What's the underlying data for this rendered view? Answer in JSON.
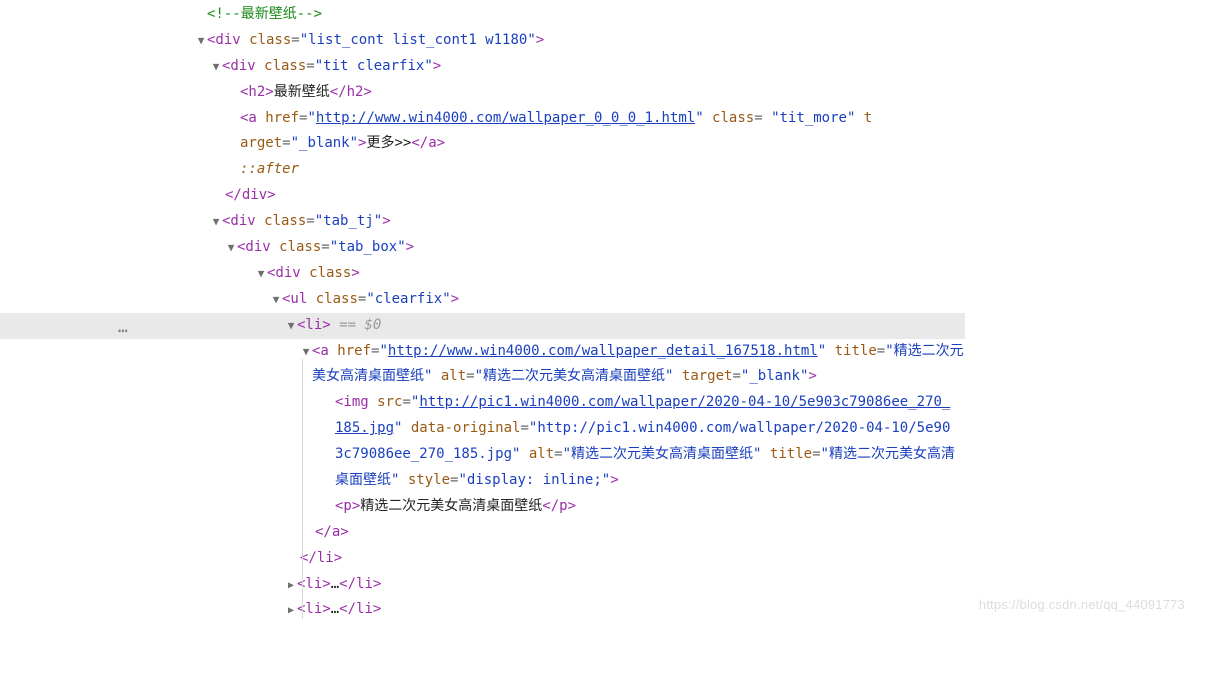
{
  "comment": "<!--最新壁纸-->",
  "l1": {
    "open": "<div",
    "cls_attr": " class",
    "eq": "=",
    "q": "\"",
    "cls_val": "list_cont list_cont1 w1180",
    "close": ">"
  },
  "l2": {
    "open": "<div",
    "cls_attr": " class",
    "eq": "=",
    "q": "\"",
    "cls_val": "tit clearfix",
    "close": ">"
  },
  "l3": {
    "open": "<h2>",
    "text": "最新壁纸",
    "close": "</h2>"
  },
  "l4": {
    "open": "<a",
    "href_attr": " href",
    "eq": "=",
    "q": "\"",
    "href_val": "http://www.win4000.com/wallpaper_0_0_0_1.html",
    "cls_attr": " class",
    "cls_val": "tit_more",
    "tgt_attr": " target",
    "tgt_val": "_blank",
    "text": "更多",
    "gtgt": ">>",
    "close_a": "</a>"
  },
  "l5": {
    "pseudo": "::after"
  },
  "l6": {
    "close": "</div>"
  },
  "l7": {
    "open": "<div",
    "cls_attr": " class",
    "eq": "=",
    "q": "\"",
    "cls_val": "tab_tj",
    "close": ">"
  },
  "l8": {
    "open": "<div",
    "cls_attr": " class",
    "eq": "=",
    "q": "\"",
    "cls_val": "tab_box",
    "close": ">"
  },
  "l9": {
    "open": "<div",
    "cls_attr": " class",
    "close": ">"
  },
  "l10": {
    "open": "<ul",
    "cls_attr": " class",
    "eq": "=",
    "q": "\"",
    "cls_val": "clearfix",
    "close": ">"
  },
  "l11": {
    "open": "<li>",
    "hint": " == $0"
  },
  "l12": {
    "open": "<a",
    "href_attr": " href",
    "eq": "=",
    "q": "\"",
    "href_val": "http://www.win4000.com/wallpaper_detail_167518.html",
    "title_attr": "title",
    "title_val": "精选二次元美女高清桌面壁纸",
    "alt_attr": " alt",
    "alt_val": "精选二次元美女高清桌面壁纸",
    "tgt_attr": " target",
    "tgt_val": "_blank",
    "close": ">"
  },
  "l13": {
    "open": "<img",
    "src_attr": " src",
    "eq": "=",
    "q": "\"",
    "src_val": "http://pic1.win4000.com/wallpaper/2020-04-10/5e903c79086ee_270_185.jpg",
    "do_attr": " data-original",
    "do_val_p1": "http://",
    "do_val_p2": "pic1.win4000.com/wallpaper/2020-04-10/",
    "do_val_p3": "5e903c79086ee_270_185.jpg",
    "alt_attr": " alt",
    "alt_val": "精选二次元美女高清桌面壁纸",
    "title_attr": "title",
    "title_val": "精选二次元美女高清桌面壁纸",
    "style_attr": " style",
    "style_val": "display: inline;",
    "close": ">"
  },
  "l14": {
    "open": "<p>",
    "text": "精选二次元美女高清桌面壁纸",
    "close": "</p>"
  },
  "l15": {
    "close": "</a>"
  },
  "l16": {
    "close": "</li>"
  },
  "l17": {
    "open": "<li>",
    "dots": "…",
    "close": "</li>"
  },
  "l18": {
    "open": "<li>",
    "dots": "…",
    "close": "</li>"
  },
  "watermark": "https://blog.csdn.net/qq_44091773"
}
